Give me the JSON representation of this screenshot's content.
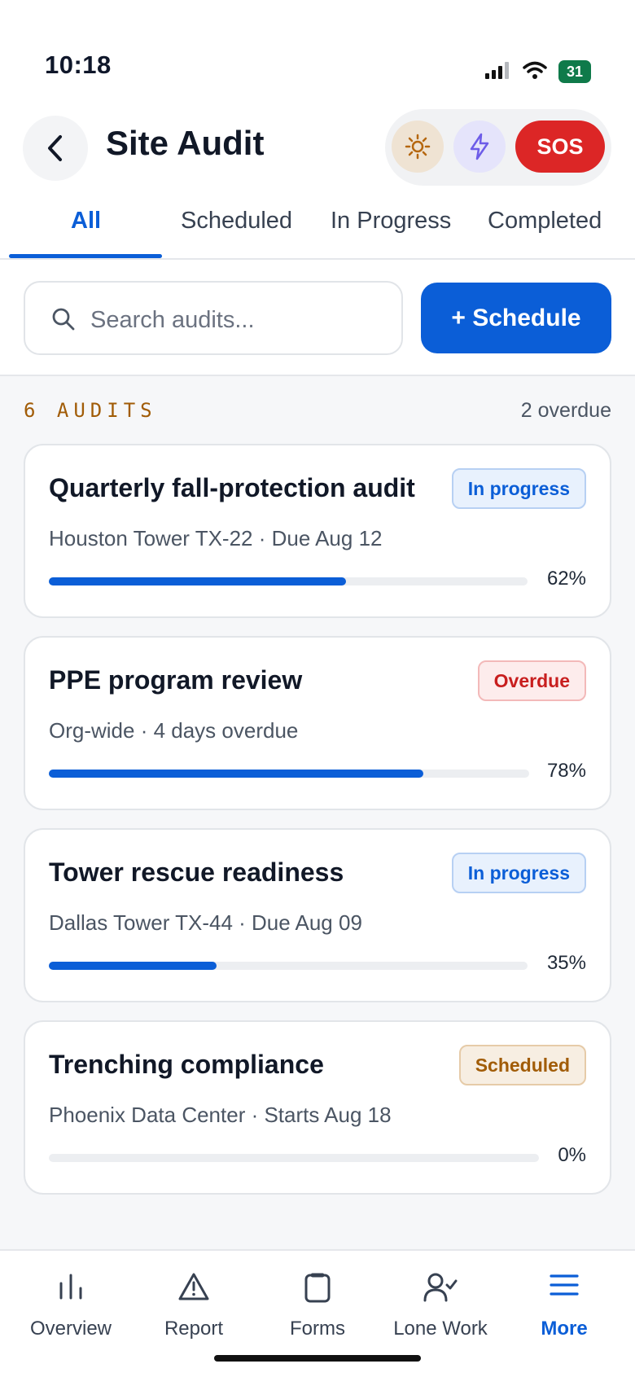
{
  "status_bar": {
    "time": "10:18",
    "battery": "31"
  },
  "header": {
    "title": "Site Audit",
    "sos_label": "SOS"
  },
  "tabs": [
    {
      "label": "All",
      "active": true
    },
    {
      "label": "Scheduled",
      "active": false
    },
    {
      "label": "In Progress",
      "active": false
    },
    {
      "label": "Completed",
      "active": false
    }
  ],
  "search": {
    "placeholder": "Search audits...",
    "value": ""
  },
  "schedule_button": "+ Schedule",
  "summary": {
    "count_label": "6 AUDITS",
    "overdue_label": "2 overdue"
  },
  "audits": [
    {
      "title": "Quarterly fall-protection audit",
      "status": "In progress",
      "status_kind": "progress",
      "subtitle": "Houston Tower TX-22 · Due Aug 12",
      "progress": 0.62,
      "progress_label": "62%"
    },
    {
      "title": "PPE program review",
      "status": "Overdue",
      "status_kind": "overdue",
      "subtitle": "Org-wide · 4 days overdue",
      "progress": 0.78,
      "progress_label": "78%"
    },
    {
      "title": "Tower rescue readiness",
      "status": "In progress",
      "status_kind": "progress",
      "subtitle": "Dallas Tower TX-44 · Due Aug 09",
      "progress": 0.35,
      "progress_label": "35%"
    },
    {
      "title": "Trenching compliance",
      "status": "Scheduled",
      "status_kind": "scheduled",
      "subtitle": "Phoenix Data Center · Starts Aug 18",
      "progress": 0.0,
      "progress_label": "0%"
    }
  ],
  "bottom_nav": [
    {
      "label": "Overview",
      "icon": "bar-chart-icon",
      "active": false
    },
    {
      "label": "Report",
      "icon": "warning-icon",
      "active": false
    },
    {
      "label": "Forms",
      "icon": "clipboard-icon",
      "active": false
    },
    {
      "label": "Lone Work",
      "icon": "user-check-icon",
      "active": false
    },
    {
      "label": "More",
      "icon": "menu-icon",
      "active": true
    }
  ],
  "colors": {
    "accent": "#0b5ed7",
    "sos": "#dc2626",
    "overdue": "#c81e1e",
    "scheduled": "#a15c07"
  }
}
